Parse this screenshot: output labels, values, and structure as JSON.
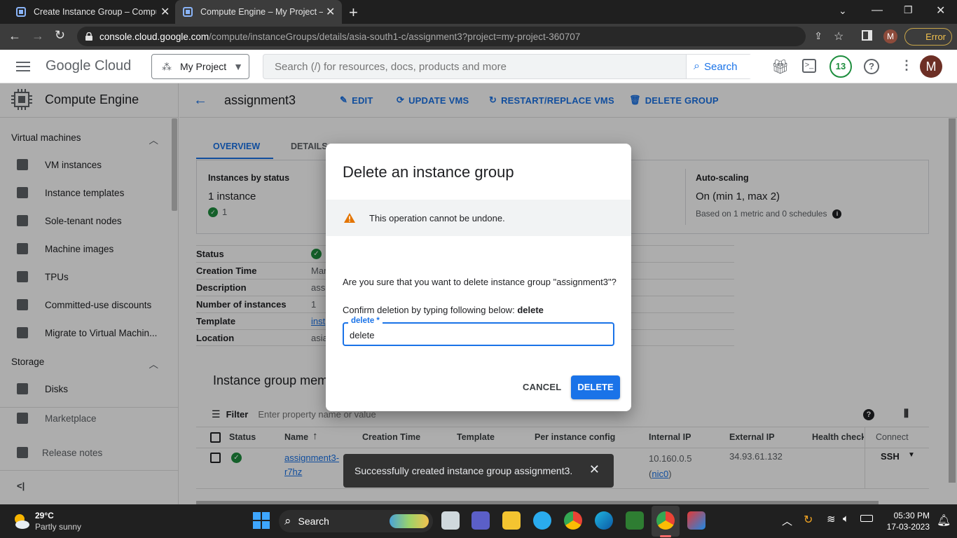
{
  "browser": {
    "tabs": [
      {
        "title": "Create Instance Group – Comput"
      },
      {
        "title": "Compute Engine – My Project – C"
      }
    ],
    "url_host": "console.cloud.google.com",
    "url_path": "/compute/instanceGroups/details/asia-south1-c/assignment3?project=my-project-360707",
    "profile_initial": "M",
    "error_label": "Error"
  },
  "header": {
    "logo": "Google Cloud",
    "project": "My Project",
    "search_placeholder": "Search (/) for resources, docs, products and more",
    "search_button": "Search",
    "notif_count": "13",
    "avatar": "M"
  },
  "sidebar": {
    "title": "Compute Engine",
    "section_vm": "Virtual machines",
    "items": [
      "VM instances",
      "Instance templates",
      "Sole-tenant nodes",
      "Machine images",
      "TPUs",
      "Committed-use discounts",
      "Migrate to Virtual Machin..."
    ],
    "section_storage": "Storage",
    "storage_items": [
      "Disks"
    ],
    "marketplace": "Marketplace",
    "release_notes": "Release notes",
    "collapse": "<|"
  },
  "page": {
    "title": "assignment3",
    "actions": {
      "edit": "EDIT",
      "update": "UPDATE VMS",
      "restart": "RESTART/REPLACE VMS",
      "delete": "DELETE GROUP"
    },
    "tabs": {
      "overview": "OVERVIEW",
      "details": "DETAILS"
    },
    "status_card": {
      "label": "Instances by status",
      "value": "1 instance",
      "count": "1"
    },
    "autoscale": {
      "label": "Auto-scaling",
      "value": "On (min 1, max 2)",
      "sub": "Based on 1 metric and 0 schedules"
    },
    "props": [
      {
        "k": "Status",
        "v": ""
      },
      {
        "k": "Creation Time",
        "v": "Mar"
      },
      {
        "k": "Description",
        "v": "ass"
      },
      {
        "k": "Number of instances",
        "v": "1"
      },
      {
        "k": "Template",
        "v": "inst"
      },
      {
        "k": "Location",
        "v": "asia"
      }
    ],
    "members_title": "Instance group mem",
    "filter_label": "Filter",
    "filter_placeholder": "Enter property name or value",
    "columns": [
      "Status",
      "Name",
      "Creation Time",
      "Template",
      "Per instance config",
      "Internal IP",
      "External IP",
      "Health check s",
      "Connect"
    ],
    "row": {
      "name": "assignment3-r7hz",
      "name_line1": "assignment3-",
      "name_line2": "r7hz",
      "internal_ip": "10.160.0.5",
      "nic": "nic0",
      "external_ip": "34.93.61.132",
      "connect": "SSH"
    }
  },
  "dialog": {
    "title": "Delete an instance group",
    "warning": "This operation cannot be undone.",
    "question": "Are you sure that you want to delete instance group \"assignment3\"?",
    "confirm_prefix": "Confirm deletion by typing following below: ",
    "confirm_word": "delete",
    "input_label": "delete *",
    "input_value": "delete",
    "cancel": "CANCEL",
    "delete": "DELETE"
  },
  "snackbar": {
    "message": "Successfully created instance group assignment3."
  },
  "taskbar": {
    "temp": "29°C",
    "weather": "Partly sunny",
    "search": "Search",
    "time": "05:30 PM",
    "date": "17-03-2023"
  },
  "colors": {
    "accent": "#1a73e8",
    "warning": "#e37400",
    "success": "#1e8e3e"
  }
}
